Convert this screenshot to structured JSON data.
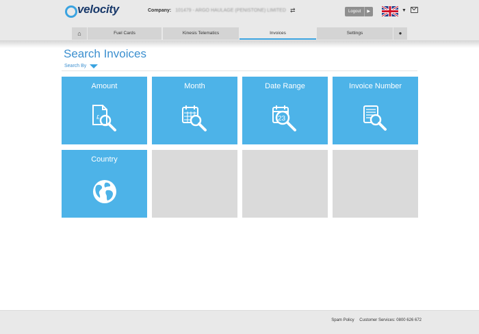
{
  "header": {
    "logo_text": "velocity",
    "company_label": "Company:",
    "company_value": "101479 - ARGO HAULAGE (PENISTONE) LIMITED",
    "logout_label": "Logout",
    "swap_icon": "swap-icon",
    "flag_icon": "uk-flag-icon",
    "mail_icon": "envelope-icon"
  },
  "nav": {
    "items": [
      {
        "label": "",
        "icon": "home-icon"
      },
      {
        "label": "Fuel Cards"
      },
      {
        "label": "Kinesis Telematics"
      },
      {
        "label": "Invoices",
        "active": true
      },
      {
        "label": "Settings"
      },
      {
        "label": "",
        "icon": "user-icon"
      }
    ]
  },
  "page": {
    "title": "Search Invoices",
    "search_by": "Search By"
  },
  "tiles": [
    {
      "label": "Amount",
      "icon": "amount-search-icon"
    },
    {
      "label": "Month",
      "icon": "calendar-search-icon"
    },
    {
      "label": "Date Range",
      "icon": "date-range-search-icon",
      "date_number": "23"
    },
    {
      "label": "Invoice Number",
      "icon": "invoice-search-icon"
    },
    {
      "label": "Country",
      "icon": "globe-icon"
    }
  ],
  "footer": {
    "spam_policy": "Spam Policy",
    "customer_services": "Customer Services: 0800 626 672"
  },
  "colors": {
    "accent": "#4db3e8",
    "title": "#3b8fcf",
    "empty_tile": "#dadada"
  }
}
